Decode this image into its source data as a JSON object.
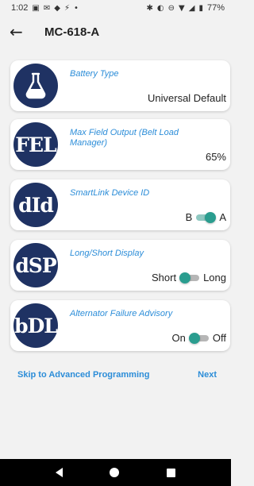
{
  "status": {
    "time": "1:02",
    "left_icons": [
      "gallery-icon",
      "message-icon",
      "drive-icon",
      "usb-icon",
      "dot-icon"
    ],
    "right_icons": [
      "bluetooth-icon",
      "vibrate-icon",
      "dnd-icon",
      "wifi-icon",
      "signal-icon",
      "battery-icon"
    ],
    "battery": "77%"
  },
  "header": {
    "back_icon": "arrow-back-icon",
    "title": "MC-618-A"
  },
  "settings": [
    {
      "badge": "",
      "icon": "flask-icon",
      "label": "Battery Type",
      "value": "Universal Default"
    },
    {
      "badge": "FEL",
      "label": "Max Field Output (Belt Load Manager)",
      "value": "65%"
    },
    {
      "badge": "dId",
      "label": "SmartLink Device ID",
      "left_option": "B",
      "right_option": "A",
      "selected": "A"
    },
    {
      "badge": "dSP",
      "label": "Long/Short Display",
      "left_option": "Short",
      "right_option": "Long",
      "selected": "Short"
    },
    {
      "badge": "bDL",
      "label": "Alternator Failure Advisory",
      "left_option": "On",
      "right_option": "Off",
      "selected": "On"
    }
  ],
  "actions": {
    "skip_label": "Skip to Advanced Programming",
    "next_label": "Next"
  },
  "colors": {
    "badge": "#1f3263",
    "accent": "#2c8dd8",
    "toggle": "#2a9d8f"
  }
}
